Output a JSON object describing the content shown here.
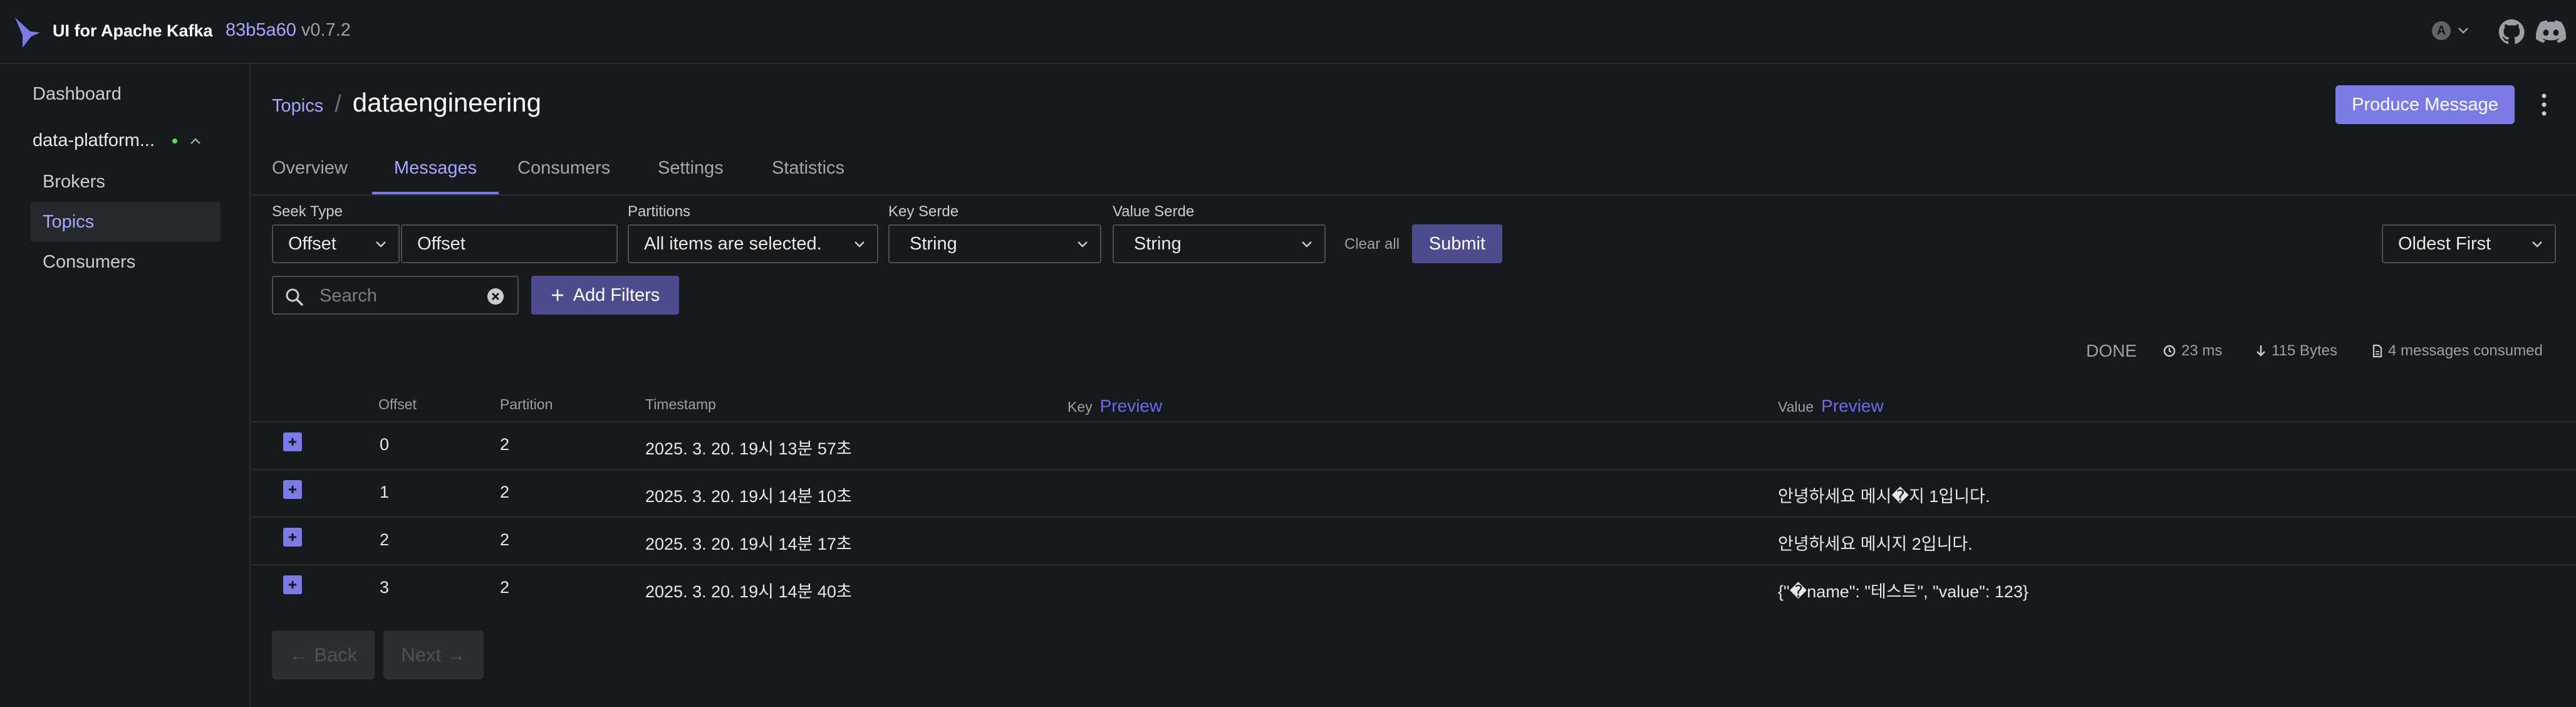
{
  "header": {
    "app_title": "UI for Apache Kafka",
    "build": "83b5a60",
    "version": "v0.7.2",
    "theme_letter": "A"
  },
  "sidebar": {
    "dashboard": "Dashboard",
    "cluster_name": "data-platform...",
    "items": [
      {
        "label": "Brokers"
      },
      {
        "label": "Topics"
      },
      {
        "label": "Consumers"
      }
    ]
  },
  "breadcrumb": {
    "parent": "Topics",
    "separator": "/",
    "current": "dataengineering"
  },
  "actions": {
    "produce_message": "Produce Message"
  },
  "tabs": [
    {
      "label": "Overview"
    },
    {
      "label": "Messages"
    },
    {
      "label": "Consumers"
    },
    {
      "label": "Settings"
    },
    {
      "label": "Statistics"
    }
  ],
  "filters": {
    "seek_type_label": "Seek Type",
    "seek_type_value": "Offset",
    "offset_value": "Offset",
    "partitions_label": "Partitions",
    "partitions_value": "All items are selected.",
    "key_serde_label": "Key Serde",
    "key_serde_value": "String",
    "value_serde_label": "Value Serde",
    "value_serde_value": "String",
    "clear_all": "Clear all",
    "submit": "Submit",
    "sort": "Oldest First",
    "search_placeholder": "Search",
    "add_filters": "Add Filters"
  },
  "stats": {
    "status": "DONE",
    "elapsed": "23 ms",
    "bytes": "115 Bytes",
    "consumed": "4 messages consumed"
  },
  "table": {
    "columns": {
      "offset": "Offset",
      "partition": "Partition",
      "timestamp": "Timestamp",
      "key": "Key",
      "value": "Value",
      "preview": "Preview"
    },
    "rows": [
      {
        "offset": "0",
        "partition": "2",
        "timestamp": "2025. 3. 20. 19시 13분 57초",
        "value": ""
      },
      {
        "offset": "1",
        "partition": "2",
        "timestamp": "2025. 3. 20. 19시 14분 10초",
        "value": "안녕하세요 메시�지 1입니다."
      },
      {
        "offset": "2",
        "partition": "2",
        "timestamp": "2025. 3. 20. 19시 14분 17초",
        "value": "안녕하세요 메시지 2입니다."
      },
      {
        "offset": "3",
        "partition": "2",
        "timestamp": "2025. 3. 20. 19시 14분 40초",
        "value": "{\"�name\": \"테스트\", \"value\": 123}"
      }
    ]
  },
  "pagination": {
    "back": "← Back",
    "next": "Next →"
  }
}
